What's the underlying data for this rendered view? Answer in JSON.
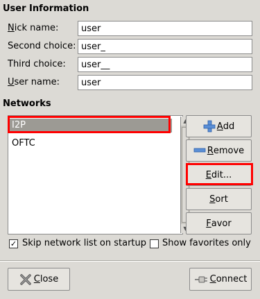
{
  "user_info": {
    "title": "User Information",
    "nick_label_u": "N",
    "nick_label_rest": "ick name:",
    "nick_value": "user",
    "second_label": "Second choice:",
    "second_value": "user_",
    "third_label": "Third choice:",
    "third_value": "user__",
    "user_label_u": "U",
    "user_label_rest": "ser name:",
    "user_value": "user"
  },
  "networks": {
    "title": "Networks",
    "items": [
      {
        "label": "I2P",
        "selected": true
      },
      {
        "label": "OFTC",
        "selected": false
      }
    ]
  },
  "buttons": {
    "add_u": "A",
    "add_rest": "dd",
    "remove_u": "R",
    "remove_rest": "emove",
    "edit_u": "E",
    "edit_rest": "dit...",
    "sort_u": "S",
    "sort_rest": "ort",
    "favor_u": "F",
    "favor_rest": "avor"
  },
  "options": {
    "skip_label": "Skip network list on startup",
    "skip_checked": true,
    "favorites_label": "Show favorites only",
    "favorites_checked": false
  },
  "footer": {
    "close_u": "C",
    "close_rest": "lose",
    "connect_u": "C",
    "connect_rest": "onnect"
  },
  "colors": {
    "highlight": "#ff0000",
    "selection": "#9c9a94"
  }
}
